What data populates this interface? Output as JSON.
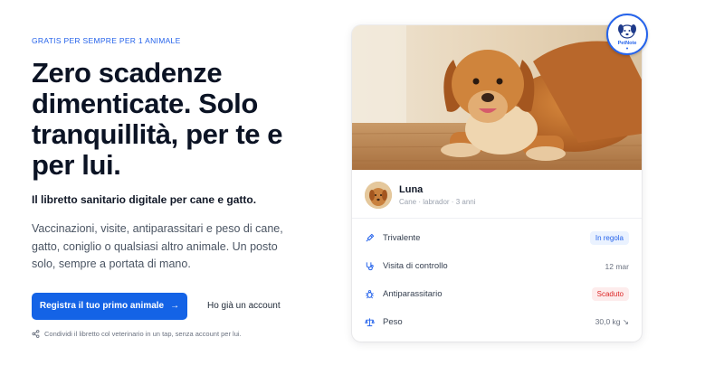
{
  "hero": {
    "eyebrow": "GRATIS PER SEMPRE PER 1 ANIMALE",
    "headline": "Zero scadenze dimenticate. Solo tranquillità, per te e per lui.",
    "subheadline": "Il libretto sanitario digitale per cane e gatto.",
    "description": "Vaccinazioni, visite, antiparassitari e peso di cane, gatto, coniglio o qualsiasi altro animale. Un posto solo, sempre a portata di mano.",
    "primary_cta": "Registra il tuo primo animale",
    "primary_cta_icon": "arrow-right-icon",
    "secondary_cta": "Ho già un account",
    "share_note": "Condividi il libretto col veterinario in un tap, senza account per lui.",
    "share_icon": "share-icon"
  },
  "brand": {
    "logo_text": "PetNote",
    "accent_color": "#1463e6"
  },
  "pet_card": {
    "name": "Luna",
    "meta": "Cane · labrador · 3 anni",
    "records": [
      {
        "label": "Trivalente",
        "icon": "syringe-icon",
        "status": "In regola",
        "status_type": "ok",
        "status_color": "#2563eb"
      },
      {
        "label": "Visita di controllo",
        "icon": "stethoscope-icon",
        "value": "12 mar"
      },
      {
        "label": "Antiparassitario",
        "icon": "bug-icon",
        "status": "Scaduto",
        "status_type": "bad",
        "status_color": "#dc2626"
      },
      {
        "label": "Peso",
        "icon": "scale-icon",
        "value": "30,0 kg ↘"
      }
    ]
  }
}
